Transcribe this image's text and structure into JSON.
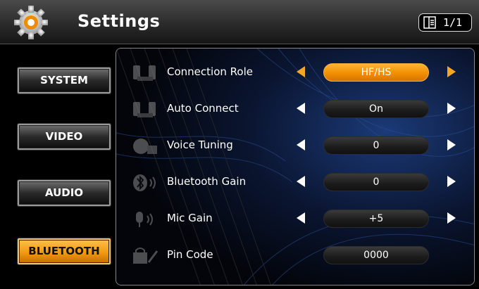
{
  "header": {
    "title": "Settings",
    "page_indicator": "1/1"
  },
  "tabs": [
    {
      "label": "SYSTEM",
      "active": false
    },
    {
      "label": "VIDEO",
      "active": false
    },
    {
      "label": "AUDIO",
      "active": false
    },
    {
      "label": "BLUETOOTH",
      "active": true
    }
  ],
  "settings": [
    {
      "label": "Connection Role",
      "value": "HF/HS",
      "icon": "phone-auto-icon",
      "highlighted": true,
      "has_arrows": true
    },
    {
      "label": "Auto Connect",
      "value": "On",
      "icon": "phone-auto-icon",
      "highlighted": false,
      "has_arrows": true
    },
    {
      "label": "Voice Tuning",
      "value": "0",
      "icon": "voice-tuning-icon",
      "highlighted": false,
      "has_arrows": true
    },
    {
      "label": "Bluetooth Gain",
      "value": "0",
      "icon": "bluetooth-gain-icon",
      "highlighted": false,
      "has_arrows": true
    },
    {
      "label": "Mic Gain",
      "value": "+5",
      "icon": "mic-gain-icon",
      "highlighted": false,
      "has_arrows": true
    },
    {
      "label": "Pin Code",
      "value": "0000",
      "icon": "pin-code-icon",
      "highlighted": false,
      "has_arrows": false
    }
  ],
  "colors": {
    "accent": "#f29a10",
    "accent_arrow": "#f5a623",
    "background": "#000000"
  }
}
